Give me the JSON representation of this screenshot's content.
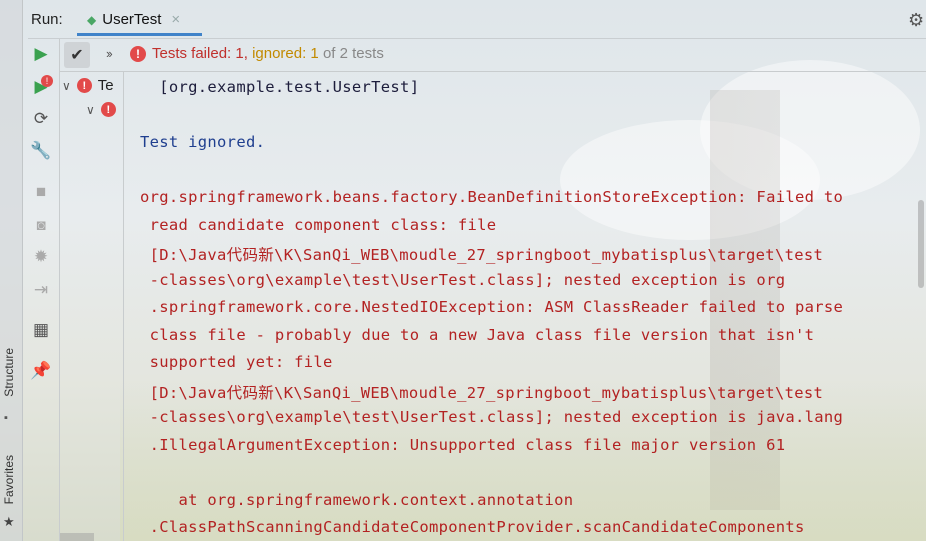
{
  "run_label": "Run:",
  "tab": {
    "title": "UserTest",
    "close": "×"
  },
  "side_tabs": {
    "structure": "Structure",
    "favorites": "Favorites"
  },
  "status": {
    "failed": "Tests failed: 1,",
    "ignored": "ignored: 1",
    "total": "of 2 tests"
  },
  "tree": [
    {
      "label": "Te",
      "badge": "!"
    },
    {
      "label": "",
      "badge": "!"
    }
  ],
  "console": {
    "lines": [
      "  [org.example.test.UserTest]",
      "Test ignored.",
      "org.springframework.beans.factory.BeanDefinitionStoreException: Failed to",
      " read candidate component class: file",
      " [D:\\Java代码新\\K\\SanQi_WEB\\moudle_27_springboot_mybatisplus\\target\\test",
      " -classes\\org\\example\\test\\UserTest.class]; nested exception is org",
      " .springframework.core.NestedIOException: ASM ClassReader failed to parse",
      " class file - probably due to a new Java class file version that isn't",
      " supported yet: file",
      " [D:\\Java代码新\\K\\SanQi_WEB\\moudle_27_springboot_mybatisplus\\target\\test",
      " -classes\\org\\example\\test\\UserTest.class]; nested exception is java.lang",
      " .IllegalArgumentException: Unsupported class file major version 61",
      "    at org.springframework.context.annotation",
      " .ClassPathScanningCandidateComponentProvider.scanCandidateComponents"
    ]
  },
  "colors": {
    "error": "#b32222",
    "info": "#1f3f8f",
    "accent": "#4083c9",
    "warning": "#c28a00"
  },
  "icons": [
    "gear-icon",
    "run-icon",
    "rerun-failed-icon",
    "toggle-auto-test-icon",
    "wrench-icon",
    "stop-icon",
    "camera-icon",
    "bug-icon",
    "exit-icon",
    "layout-icon",
    "pin-icon",
    "check-icon",
    "chevron-double-icon",
    "error-icon"
  ]
}
